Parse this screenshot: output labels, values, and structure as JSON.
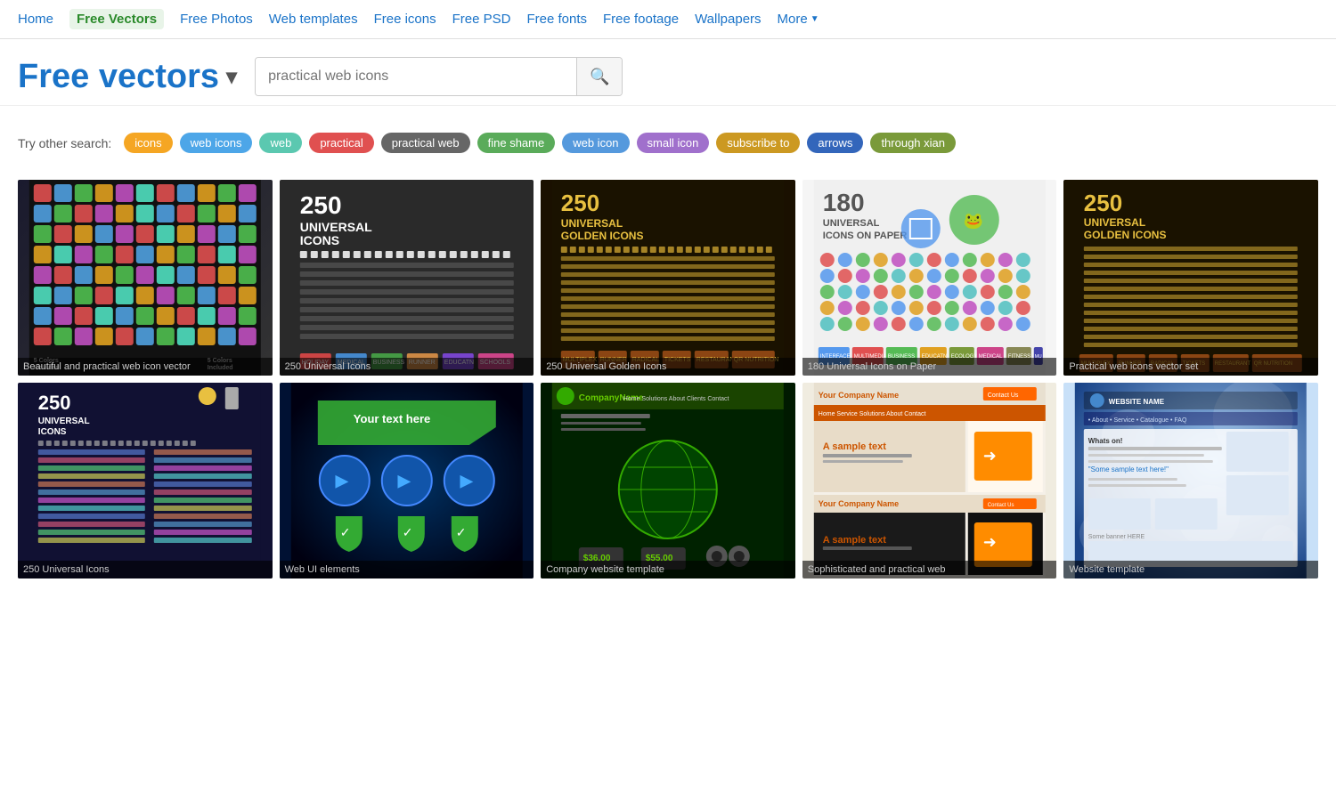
{
  "nav": {
    "home": "Home",
    "active": "Free Vectors",
    "links": [
      "Free Photos",
      "Web templates",
      "Free icons",
      "Free PSD",
      "Free fonts",
      "Free footage",
      "Wallpapers"
    ],
    "more": "More"
  },
  "header": {
    "title": "Free vectors",
    "arrow": "▾",
    "search_placeholder": "practical web icons",
    "search_button_icon": "🔍"
  },
  "suggestions": {
    "label": "Try other search:",
    "tags": [
      {
        "text": "icons",
        "color": "orange"
      },
      {
        "text": "web icons",
        "color": "blue"
      },
      {
        "text": "web",
        "color": "teal"
      },
      {
        "text": "practical",
        "color": "red"
      },
      {
        "text": "practical web",
        "color": "darkgray"
      },
      {
        "text": "fine shame",
        "color": "green"
      },
      {
        "text": "web icon",
        "color": "lightblue"
      },
      {
        "text": "small icon",
        "color": "purple"
      },
      {
        "text": "subscribe to",
        "color": "gold"
      },
      {
        "text": "arrows",
        "color": "darkblue"
      },
      {
        "text": "through xian",
        "color": "olive"
      }
    ]
  },
  "grid_row1": [
    {
      "title": "Beautiful and practical web icon vector",
      "badge": ""
    },
    {
      "title": "250 Universal Icons",
      "badge": ""
    },
    {
      "title": "250 Universal Golden Icons",
      "badge": ""
    },
    {
      "title": "180 Universal Icons on Paper",
      "badge": ""
    },
    {
      "title": "Practical web icons vector set",
      "badge": ""
    }
  ],
  "grid_row2": [
    {
      "title": "250 Universal Icons",
      "badge": ""
    },
    {
      "title": "Web UI elements",
      "badge": ""
    },
    {
      "title": "Company website template",
      "badge": ""
    },
    {
      "title": "Sophisticated and practical web",
      "badge": ""
    },
    {
      "title": "Website template",
      "badge": ""
    }
  ]
}
